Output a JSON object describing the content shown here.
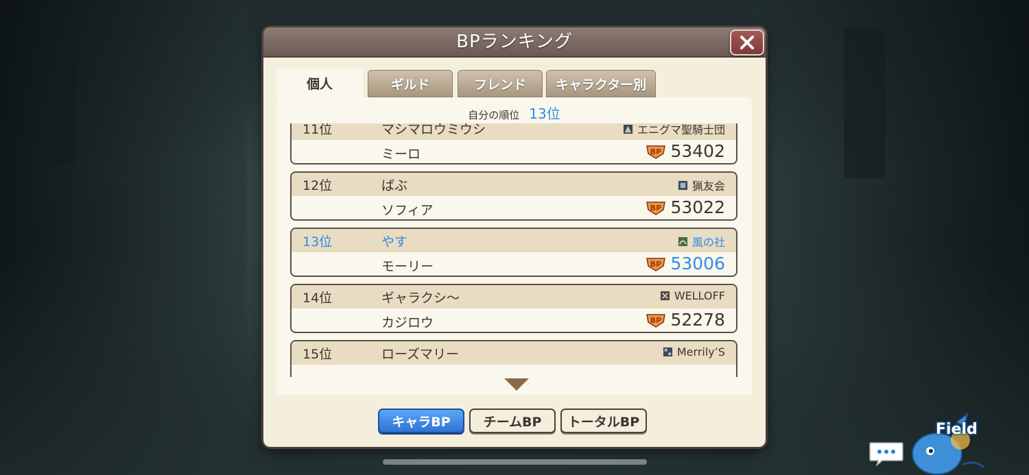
{
  "dialog": {
    "title": "BPランキング"
  },
  "tabs": [
    {
      "label": "個人",
      "active": true
    },
    {
      "label": "ギルド",
      "active": false
    },
    {
      "label": "フレンド",
      "active": false
    },
    {
      "label": "キャラクター別",
      "active": false
    }
  ],
  "my_rank": {
    "label": "自分の順位",
    "value": "13位"
  },
  "rankings": [
    {
      "rank": "11位",
      "player": "マシマロウミウシ",
      "guild": "エニグマ聖騎士団",
      "character": "ミーロ",
      "bp": "53402",
      "highlight": false
    },
    {
      "rank": "12位",
      "player": "ばぶ",
      "guild": "猟友会",
      "character": "ソフィア",
      "bp": "53022",
      "highlight": false
    },
    {
      "rank": "13位",
      "player": "やす",
      "guild": "風の社",
      "character": "モーリー",
      "bp": "53006",
      "highlight": true
    },
    {
      "rank": "14位",
      "player": "ギャラクシ〜",
      "guild": "WELLOFF",
      "character": "カジロウ",
      "bp": "52278",
      "highlight": false
    },
    {
      "rank": "15位",
      "player": "ローズマリー",
      "guild": "Merrily’S",
      "character": "",
      "bp": "",
      "highlight": false
    }
  ],
  "bp_icon_label": "BP",
  "bottom_buttons": [
    {
      "label": "キャラBP",
      "active": true
    },
    {
      "label": "チームBP",
      "active": false
    },
    {
      "label": "トータルBP",
      "active": false
    }
  ],
  "field_button": {
    "label": "Field"
  },
  "colors": {
    "accent_blue": "#2f8ce8",
    "header": "#7a6a62",
    "panel": "#faf7ec",
    "row_top": "#e8dcc2",
    "close_button": "#8c4644"
  }
}
